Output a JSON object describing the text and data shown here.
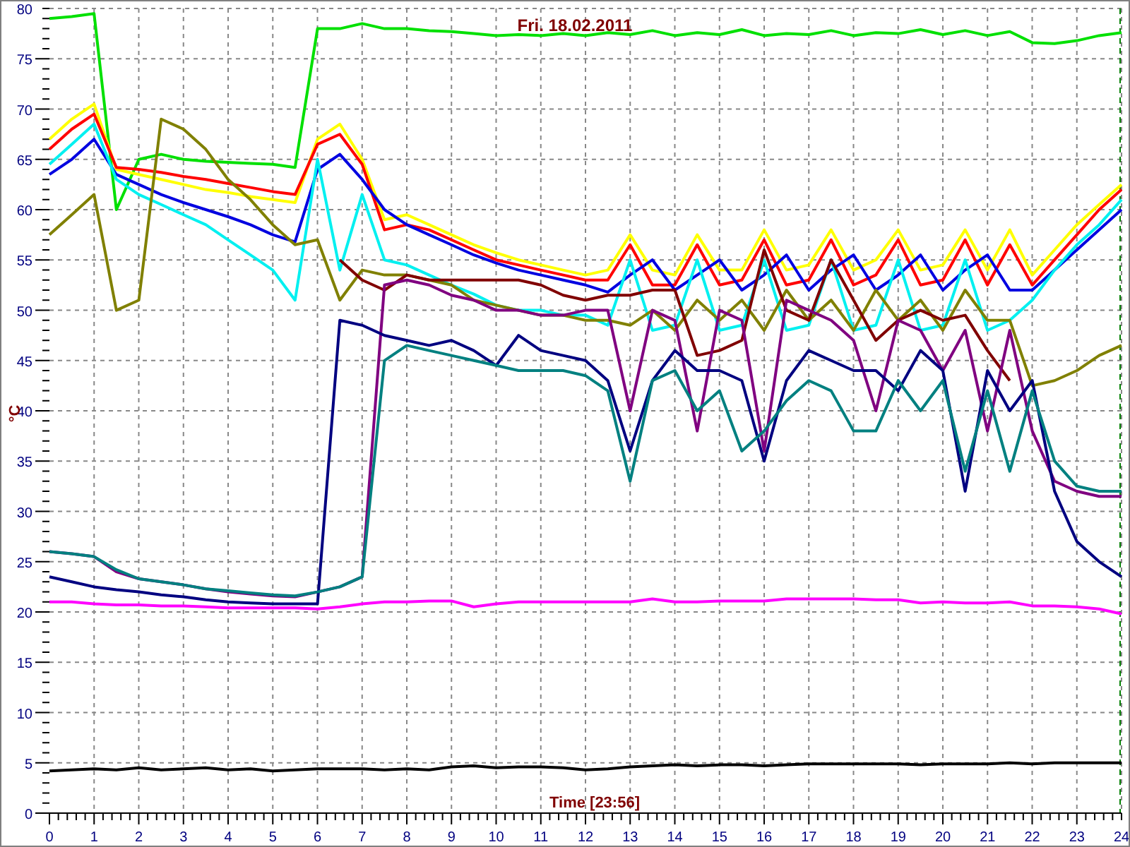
{
  "chart_data": {
    "type": "line",
    "title": "Fri. 18.02.2011",
    "xlabel": "Time [23:56]",
    "ylabel": "°C",
    "x": [
      0,
      0.5,
      1,
      1.5,
      2,
      2.5,
      3,
      3.5,
      4,
      4.5,
      5,
      5.5,
      6,
      6.5,
      7,
      7.5,
      8,
      8.5,
      9,
      9.5,
      10,
      10.5,
      11,
      11.5,
      12,
      12.5,
      13,
      13.5,
      14,
      14.5,
      15,
      15.5,
      16,
      16.5,
      17,
      17.5,
      18,
      18.5,
      19,
      19.5,
      20,
      20.5,
      21,
      21.5,
      22,
      22.5,
      23,
      23.5,
      24
    ],
    "series": [
      {
        "color": "#00e000",
        "values": [
          79,
          79.2,
          79.5,
          60,
          65,
          65.5,
          65,
          64.8,
          64.7,
          64.6,
          64.5,
          64.2,
          78,
          78,
          78.5,
          78,
          78,
          77.8,
          77.7,
          77.5,
          77.3,
          77.4,
          77.3,
          77.5,
          77.3,
          77.6,
          77.4,
          77.8,
          77.3,
          77.6,
          77.4,
          77.9,
          77.3,
          77.5,
          77.4,
          77.8,
          77.3,
          77.6,
          77.5,
          77.9,
          77.4,
          77.8,
          77.3,
          77.7,
          76.6,
          76.5,
          76.8,
          77.3,
          77.6
        ]
      },
      {
        "color": "#ffff00",
        "values": [
          67,
          69,
          70.5,
          64,
          63.5,
          63,
          62.5,
          62,
          61.7,
          61.3,
          61,
          60.7,
          67,
          68.5,
          65,
          59,
          59.5,
          58.5,
          57.5,
          56.5,
          55.7,
          55,
          54.5,
          54,
          53.5,
          54,
          57.5,
          54,
          53.5,
          57.5,
          54,
          54,
          58,
          54,
          54.5,
          58,
          54,
          55,
          58,
          54,
          54.5,
          58,
          54,
          58,
          53.5,
          56,
          58.5,
          60.5,
          62.5
        ]
      },
      {
        "color": "#ff0000",
        "values": [
          66,
          68,
          69.5,
          64.2,
          64,
          63.7,
          63.3,
          63,
          62.6,
          62.2,
          61.8,
          61.5,
          66.5,
          67.5,
          64.5,
          58,
          58.5,
          58,
          57,
          56,
          55,
          54.5,
          54,
          53.5,
          53,
          53,
          56.5,
          52.5,
          52.5,
          56.5,
          52.5,
          53,
          57,
          52.5,
          53,
          57,
          52.5,
          53.5,
          57,
          52.5,
          53,
          57,
          52.5,
          56.5,
          52.5,
          55,
          57.5,
          60,
          62
        ]
      },
      {
        "color": "#0000e0",
        "values": [
          63.5,
          65,
          67,
          63.5,
          62.5,
          61.5,
          60.7,
          60,
          59.3,
          58.5,
          57.5,
          56.8,
          64,
          65.5,
          63,
          60,
          58.5,
          57.5,
          56.5,
          55.5,
          54.7,
          54,
          53.5,
          53,
          52.5,
          51.8,
          53.5,
          55,
          52,
          53.5,
          55,
          52,
          53.5,
          55.5,
          52,
          54,
          55.5,
          52,
          53.5,
          55.5,
          52,
          54,
          55.5,
          52,
          52,
          54,
          56,
          58,
          60
        ]
      },
      {
        "color": "#00f0f0",
        "values": [
          64.5,
          66.5,
          68.5,
          63,
          61.5,
          60.5,
          59.5,
          58.5,
          57,
          55.5,
          54,
          51,
          65,
          54,
          61.5,
          55,
          54.5,
          53.5,
          52.5,
          51.6,
          50.5,
          50,
          50,
          49.5,
          49.5,
          48.5,
          55,
          48,
          48.5,
          55,
          48,
          48.5,
          55,
          48,
          48.5,
          55,
          48,
          48.5,
          55,
          48,
          48.5,
          55,
          48,
          49,
          51,
          54,
          56.5,
          58.5,
          61
        ]
      },
      {
        "color": "#808000",
        "values": [
          57.5,
          59.5,
          61.5,
          50,
          51,
          69,
          68,
          66,
          63,
          61,
          58.5,
          56.5,
          57,
          51,
          54,
          53.5,
          53.5,
          53,
          52.5,
          51,
          50.5,
          50,
          49.5,
          49.5,
          49,
          49,
          48.5,
          50,
          48,
          51,
          49,
          51,
          48,
          52,
          49,
          51,
          48,
          52,
          49,
          51,
          48,
          52,
          49,
          49,
          42.5,
          43,
          44,
          45.5,
          46.5
        ]
      },
      {
        "color": "#800000",
        "values": [
          null,
          null,
          null,
          null,
          null,
          null,
          null,
          null,
          null,
          null,
          null,
          null,
          null,
          55,
          53,
          52,
          53.5,
          53,
          53,
          53,
          53,
          53,
          52.5,
          51.5,
          51,
          51.5,
          51.5,
          52,
          52,
          45.5,
          46,
          47,
          56,
          50,
          49,
          55,
          51,
          47,
          49,
          50,
          49,
          49.5,
          46,
          43,
          null,
          null,
          null,
          null,
          null
        ]
      },
      {
        "color": "#800080",
        "values": [
          26,
          25.8,
          25.5,
          24,
          23.3,
          23,
          22.7,
          22.3,
          22,
          21.8,
          21.6,
          21.5,
          22,
          22.5,
          23.5,
          52.5,
          53,
          52.5,
          51.5,
          51,
          50,
          50,
          49.5,
          49.5,
          50,
          50,
          40,
          50,
          49,
          38,
          50,
          49,
          36,
          51,
          50,
          49,
          47,
          40,
          49,
          48,
          44,
          48,
          38,
          48,
          38,
          33,
          32,
          31.5,
          31.5
        ]
      },
      {
        "color": "#000080",
        "values": [
          23.5,
          23,
          22.5,
          22.2,
          22,
          21.7,
          21.5,
          21.2,
          21,
          20.9,
          20.8,
          20.8,
          20.8,
          49,
          48.5,
          47.5,
          47,
          46.5,
          47,
          46,
          44.5,
          47.5,
          46,
          45.5,
          45,
          43,
          36,
          43,
          46,
          44,
          44,
          43,
          35,
          43,
          46,
          45,
          44,
          44,
          42,
          46,
          44,
          32,
          44,
          40,
          43,
          32,
          27,
          25,
          23.5
        ]
      },
      {
        "color": "#008080",
        "values": [
          26,
          25.8,
          25.5,
          24.2,
          23.3,
          23,
          22.7,
          22.3,
          22.1,
          21.9,
          21.7,
          21.6,
          22,
          22.5,
          23.5,
          45,
          46.5,
          46,
          45.5,
          45,
          44.5,
          44,
          44,
          44,
          43.5,
          42,
          33,
          43,
          44,
          40,
          42,
          36,
          38,
          41,
          43,
          42,
          38,
          38,
          43,
          40,
          43,
          34,
          42,
          34,
          42,
          35,
          32.5,
          32,
          32
        ]
      },
      {
        "color": "#ff00ff",
        "values": [
          21,
          21,
          20.8,
          20.7,
          20.7,
          20.6,
          20.6,
          20.5,
          20.4,
          20.4,
          20.4,
          20.4,
          20.3,
          20.5,
          20.8,
          21,
          21,
          21.1,
          21.1,
          20.5,
          20.8,
          21,
          21,
          21,
          21,
          21,
          21,
          21.3,
          21,
          21,
          21.1,
          21.1,
          21.1,
          21.3,
          21.3,
          21.3,
          21.3,
          21.2,
          21.2,
          20.9,
          21,
          20.9,
          20.9,
          21,
          20.6,
          20.6,
          20.5,
          20.3,
          19.8
        ]
      },
      {
        "color": "#000000",
        "values": [
          4.2,
          4.3,
          4.4,
          4.3,
          4.5,
          4.3,
          4.4,
          4.5,
          4.3,
          4.4,
          4.2,
          4.3,
          4.4,
          4.4,
          4.4,
          4.3,
          4.4,
          4.3,
          4.6,
          4.7,
          4.5,
          4.6,
          4.6,
          4.5,
          4.3,
          4.4,
          4.6,
          4.7,
          4.8,
          4.7,
          4.8,
          4.8,
          4.7,
          4.8,
          4.9,
          4.9,
          4.9,
          4.9,
          4.9,
          4.8,
          4.9,
          4.9,
          4.9,
          5,
          4.9,
          5,
          5,
          5,
          5
        ]
      }
    ],
    "xlim": [
      0,
      24
    ],
    "ylim": [
      0,
      80
    ],
    "grid": true,
    "xticks": [
      0,
      1,
      2,
      3,
      4,
      5,
      6,
      7,
      8,
      9,
      10,
      11,
      12,
      13,
      14,
      15,
      16,
      17,
      18,
      19,
      20,
      21,
      22,
      23,
      24
    ],
    "yticks": [
      0,
      5,
      10,
      15,
      20,
      25,
      30,
      35,
      40,
      45,
      50,
      55,
      60,
      65,
      70,
      75,
      80
    ]
  }
}
